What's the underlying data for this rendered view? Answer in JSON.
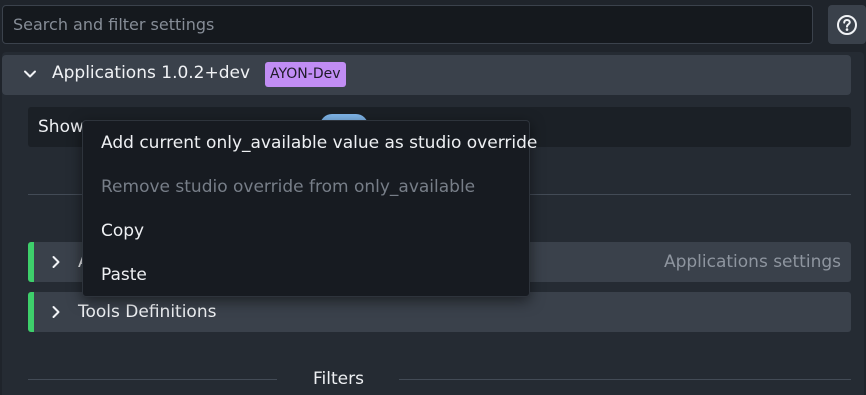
{
  "search": {
    "placeholder": "Search and filter settings",
    "value": ""
  },
  "help": {
    "icon": "question-circle-icon"
  },
  "addon": {
    "title": "Applications 1.0.2+dev",
    "badge": "AYON-Dev",
    "badge_color": "#c18df4",
    "expanded": true
  },
  "show_row": {
    "label": "Show",
    "toggle_state": "on"
  },
  "sections": [
    {
      "label": "A",
      "hint": "Applications settings",
      "accent_color": "#3ecf6b"
    },
    {
      "label": "Tools Definitions",
      "hint": "",
      "accent_color": "#3ecf6b"
    }
  ],
  "filters": {
    "label": "Filters"
  },
  "context_menu": {
    "items": [
      {
        "label": "Add current only_available value as studio override",
        "enabled": true
      },
      {
        "label": "Remove studio override from only_available",
        "enabled": false
      },
      {
        "label": "Copy",
        "enabled": true
      },
      {
        "label": "Paste",
        "enabled": true
      }
    ]
  },
  "colors": {
    "background": "#1f242b",
    "header": "#3a414b",
    "accent_green": "#3ecf6b",
    "toggle_blue": "#7fb6ea"
  }
}
